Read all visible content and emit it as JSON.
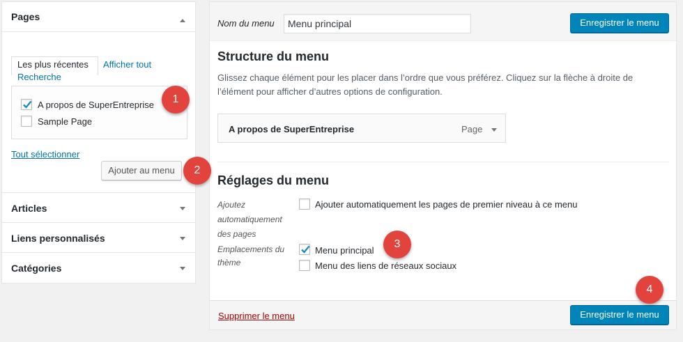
{
  "left_panel": {
    "pages": {
      "title": "Pages",
      "tabs": [
        {
          "label": "Les plus récentes"
        },
        {
          "label": "Afficher tout"
        },
        {
          "label": "Recherche"
        }
      ],
      "items": [
        {
          "label": "A propos de SuperEntreprise",
          "checked": true
        },
        {
          "label": "Sample Page",
          "checked": false
        }
      ],
      "select_all_label": "Tout sélectionner",
      "add_button_label": "Ajouter au menu"
    },
    "sections": [
      {
        "title": "Articles"
      },
      {
        "title": "Liens personnalisés"
      },
      {
        "title": "Catégories"
      }
    ]
  },
  "editor": {
    "menu_name_label": "Nom du menu",
    "menu_name_value": "Menu principal",
    "save_button_label": "Enregistrer le menu",
    "structure": {
      "title": "Structure du menu",
      "description": "Glissez chaque élément pour les placer dans l’ordre que vous préférez. Cliquez sur la flèche à droite de l’élément pour afficher d’autres options de configuration.",
      "items": [
        {
          "title": "A propos de SuperEntreprise",
          "type": "Page"
        }
      ]
    },
    "settings": {
      "title": "Réglages du menu",
      "auto_add_label": "Ajoutez automatiquement des pages",
      "auto_add_option": {
        "label": "Ajouter automatiquement les pages de premier niveau à ce menu",
        "checked": false
      },
      "locations_label": "Emplacements du thème",
      "locations": [
        {
          "label": "Menu principal",
          "checked": true
        },
        {
          "label": "Menu des liens de réseaux sociaux",
          "checked": false
        }
      ]
    },
    "footer": {
      "delete_label": "Supprimer le menu",
      "save_button_label": "Enregistrer le menu"
    }
  },
  "badges": [
    "1",
    "2",
    "3",
    "4"
  ],
  "colors": {
    "primary_button": "#0085ba",
    "link": "#0073aa",
    "delete_link": "#a00000",
    "badge": "#e2433c",
    "checkmark": "#1e8cbe"
  }
}
